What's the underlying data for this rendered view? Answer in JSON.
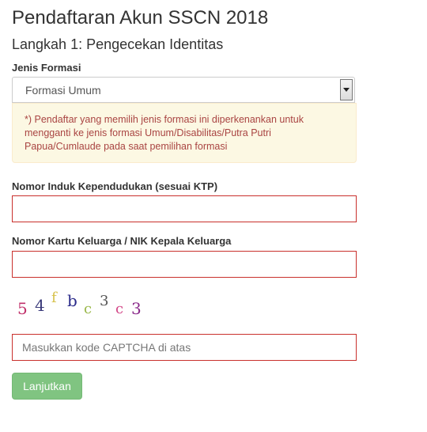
{
  "header": {
    "title": "Pendaftaran Akun SSCN 2018",
    "step": "Langkah 1: Pengecekan Identitas"
  },
  "form": {
    "formasi_label": "Jenis Formasi",
    "formasi_value": "Formasi Umum",
    "formasi_note": "*) Pendaftar yang memilih jenis formasi ini diperkenankan untuk mengganti ke jenis formasi Umum/Disabilitas/Putra Putri Papua/Cumlaude pada saat pemilihan formasi",
    "nik_label": "Nomor Induk Kependudukan (sesuai KTP)",
    "nik_value": "",
    "kk_label": "Nomor Kartu Keluarga / NIK Kepala Keluarga",
    "kk_value": "",
    "captcha_chars": [
      {
        "char": "5",
        "color": "#c0306a"
      },
      {
        "char": "4",
        "color": "#3a3a7a"
      },
      {
        "char": "f",
        "color": "#d6c14a"
      },
      {
        "char": "b",
        "color": "#2a2a8a"
      },
      {
        "char": "c",
        "color": "#9ab84a"
      },
      {
        "char": "3",
        "color": "#555555"
      },
      {
        "char": "c",
        "color": "#d44a8a"
      },
      {
        "char": "3",
        "color": "#8a2a8a"
      }
    ],
    "captcha_placeholder": "Masukkan kode CAPTCHA di atas",
    "submit_label": "Lanjutkan"
  }
}
